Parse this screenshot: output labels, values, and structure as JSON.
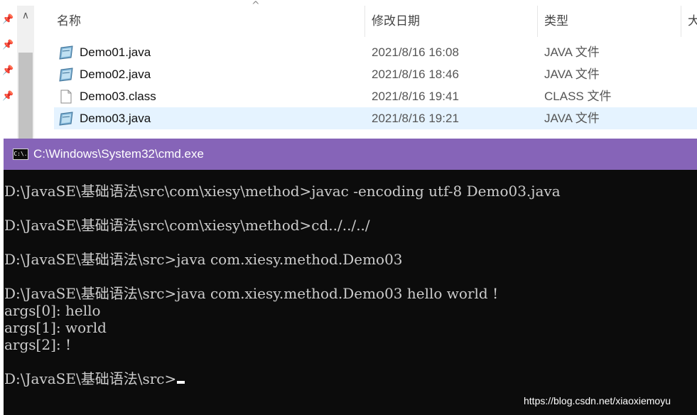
{
  "explorer": {
    "columns": {
      "name": "名称",
      "date": "修改日期",
      "type": "类型",
      "size": "大"
    },
    "files": [
      {
        "name": "Demo01.java",
        "date": "2021/8/16 16:08",
        "type": "JAVA 文件",
        "icon": "java-file-icon"
      },
      {
        "name": "Demo02.java",
        "date": "2021/8/16 18:46",
        "type": "JAVA 文件",
        "icon": "java-file-icon"
      },
      {
        "name": "Demo03.class",
        "date": "2021/8/16 19:41",
        "type": "CLASS 文件",
        "icon": "class-file-icon"
      },
      {
        "name": "Demo03.java",
        "date": "2021/8/16 19:21",
        "type": "JAVA 文件",
        "icon": "java-file-icon"
      }
    ]
  },
  "cmd": {
    "title": "C:\\Windows\\System32\\cmd.exe",
    "icon_text": "C:\\.",
    "lines": [
      "D:\\JavaSE\\基础语法\\src\\com\\xiesy\\method>javac -encoding utf-8 Demo03.java",
      "",
      "D:\\JavaSE\\基础语法\\src\\com\\xiesy\\method>cd../../../",
      "",
      "D:\\JavaSE\\基础语法\\src>java com.xiesy.method.Demo03",
      "",
      "D:\\JavaSE\\基础语法\\src>java com.xiesy.method.Demo03 hello world !",
      "args[0]: hello",
      "args[1]: world",
      "args[2]: !",
      "",
      "D:\\JavaSE\\基础语法\\src>"
    ]
  },
  "watermark": "https://blog.csdn.net/xiaoxiemoyu",
  "colors": {
    "title_bar": "#8664b8",
    "console_bg": "#0c0c0c",
    "console_text": "#cccccc",
    "selected_row": "#e5f3ff"
  }
}
